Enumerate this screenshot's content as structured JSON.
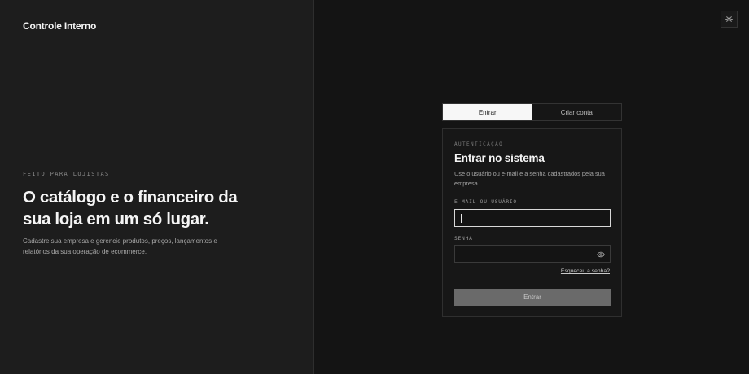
{
  "brand": {
    "name": "Controle Interno"
  },
  "hero": {
    "eyebrow": "FEITO PARA LOJISTAS",
    "headline": "O catálogo e o financeiro da sua loja em um só lugar.",
    "description": "Cadastre sua empresa e gerencie produtos, preços, lançamentos e relatórios da sua operação de ecommerce."
  },
  "header": {
    "theme_icon": "sun-icon"
  },
  "tabs": [
    {
      "label": "Entrar",
      "active": true
    },
    {
      "label": "Criar conta",
      "active": false
    }
  ],
  "login": {
    "eyebrow": "AUTENTICAÇÃO",
    "title": "Entrar no sistema",
    "subtitle": "Use o usuário ou e-mail e a senha cadastrados pela sua empresa.",
    "email_label": "E-MAIL OU USUÁRIO",
    "email_value": "",
    "password_label": "SENHA",
    "password_value": "",
    "password_toggle_icon": "eye-icon",
    "forgot_label": "Esqueceu a senha?",
    "submit_label": "Entrar"
  }
}
